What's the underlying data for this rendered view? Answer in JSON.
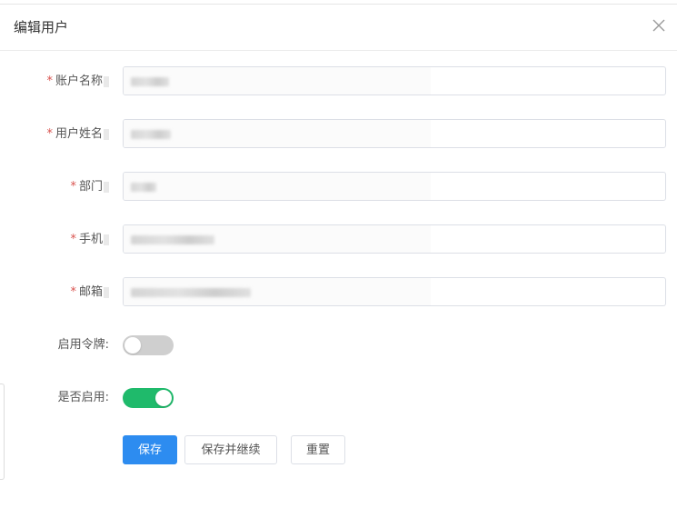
{
  "dialog": {
    "title": "编辑用户",
    "close_icon": "close-icon"
  },
  "form": {
    "fields": [
      {
        "label": "账户名称",
        "required_mark": "*"
      },
      {
        "label": "用户姓名",
        "required_mark": "*"
      },
      {
        "label": "部门",
        "required_mark": "*"
      },
      {
        "label": "手机",
        "required_mark": "*"
      },
      {
        "label": "邮箱",
        "required_mark": "*"
      }
    ],
    "token_toggle": {
      "label": "启用令牌:",
      "enabled": false
    },
    "enable_toggle": {
      "label": "是否启用:",
      "enabled": true
    }
  },
  "buttons": {
    "save": "保存",
    "save_continue": "保存并继续",
    "reset": "重置"
  },
  "colors": {
    "primary": "#2d8cf0",
    "switch_on": "#1fba6b",
    "switch_off": "#cfcfcf",
    "required": "#d9534f"
  }
}
